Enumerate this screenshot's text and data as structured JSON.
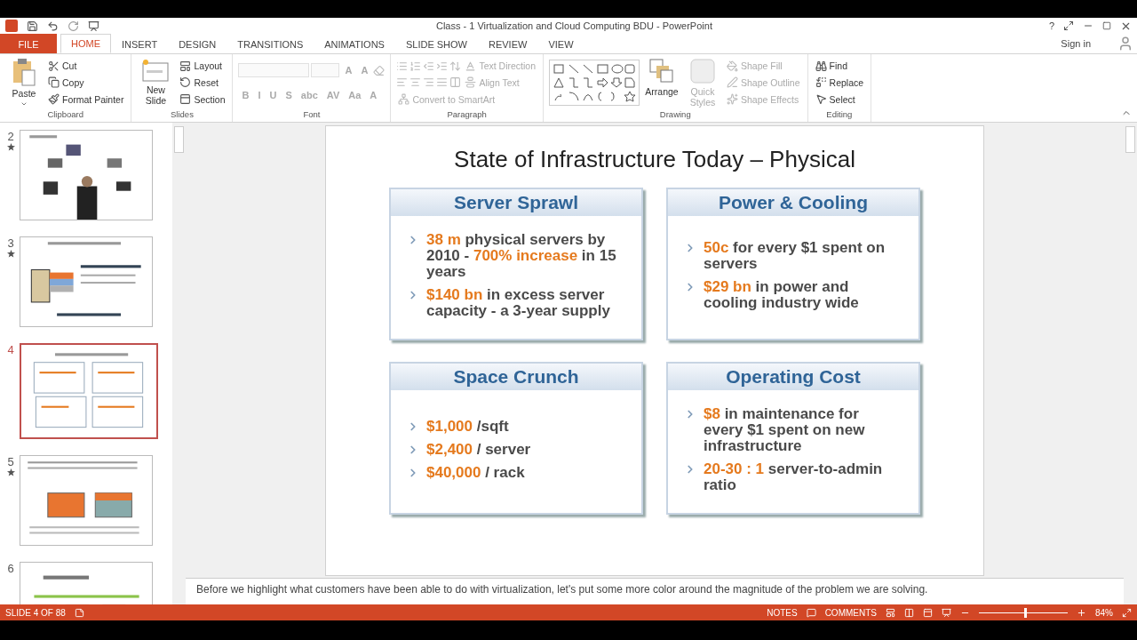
{
  "window": {
    "title": "Class - 1 Virtualization and Cloud Computing BDU - PowerPoint",
    "help": "?",
    "sign_in": "Sign in"
  },
  "tabs": [
    {
      "label": "FILE",
      "kind": "file",
      "selected": false
    },
    {
      "label": "HOME",
      "kind": "tab",
      "selected": true
    },
    {
      "label": "INSERT",
      "kind": "tab",
      "selected": false
    },
    {
      "label": "DESIGN",
      "kind": "tab",
      "selected": false
    },
    {
      "label": "TRANSITIONS",
      "kind": "tab",
      "selected": false
    },
    {
      "label": "ANIMATIONS",
      "kind": "tab",
      "selected": false
    },
    {
      "label": "SLIDE SHOW",
      "kind": "tab",
      "selected": false
    },
    {
      "label": "REVIEW",
      "kind": "tab",
      "selected": false
    },
    {
      "label": "VIEW",
      "kind": "tab",
      "selected": false
    }
  ],
  "ribbon": {
    "groups": [
      {
        "label": "Clipboard",
        "large": [
          {
            "kind": "paste",
            "label": "Paste",
            "disabled": false
          }
        ],
        "lines": [
          [
            {
              "kind": "cut",
              "label": "Cut",
              "disabled": false
            }
          ],
          [
            {
              "kind": "copy",
              "label": "Copy",
              "disabled": false
            }
          ],
          [
            {
              "kind": "painter",
              "label": "Format Painter",
              "disabled": false
            }
          ]
        ]
      },
      {
        "label": "Slides",
        "large": [
          {
            "kind": "new-slide",
            "label": "New Slide",
            "disabled": false
          }
        ],
        "lines": [
          [
            {
              "kind": "layout",
              "label": "Layout",
              "disabled": false
            }
          ],
          [
            {
              "kind": "reset",
              "label": "Reset",
              "disabled": false
            }
          ],
          [
            {
              "kind": "section",
              "label": "Section",
              "disabled": false
            }
          ]
        ]
      },
      {
        "label": "Font",
        "lines": [
          [
            {
              "kind": "font-field",
              "disabled": true
            },
            {
              "kind": "size-field",
              "disabled": true
            },
            {
              "kind": "letter",
              "label": "A",
              "disabled": true
            },
            {
              "kind": "letter",
              "label": "A",
              "disabled": true
            },
            {
              "kind": "eraser",
              "disabled": true
            }
          ],
          [
            {
              "kind": "letter",
              "label": "B",
              "disabled": true
            },
            {
              "kind": "letter",
              "label": "I",
              "disabled": true
            },
            {
              "kind": "letter",
              "label": "U",
              "disabled": true
            },
            {
              "kind": "letter",
              "label": "S",
              "disabled": true
            },
            {
              "kind": "letter",
              "label": "abc",
              "disabled": true
            },
            {
              "kind": "letter",
              "label": "AV",
              "disabled": true
            },
            {
              "kind": "letter",
              "label": "Aa",
              "disabled": true
            },
            {
              "kind": "letter",
              "label": "A",
              "disabled": true
            }
          ]
        ]
      },
      {
        "label": "Paragraph",
        "lines": [
          [
            {
              "kind": "bullets",
              "disabled": true
            },
            {
              "kind": "numbering",
              "disabled": true
            },
            {
              "kind": "outdent",
              "disabled": true
            },
            {
              "kind": "indent",
              "disabled": true
            },
            {
              "kind": "spacing",
              "disabled": true
            },
            {
              "kind": "text-direction",
              "label": "Text Direction",
              "disabled": true
            }
          ],
          [
            {
              "kind": "align-left",
              "disabled": true
            },
            {
              "kind": "align-center",
              "disabled": true
            },
            {
              "kind": "align-right",
              "disabled": true
            },
            {
              "kind": "justify",
              "disabled": true
            },
            {
              "kind": "columns",
              "disabled": true
            },
            {
              "kind": "align-text",
              "label": "Align Text",
              "disabled": true
            }
          ],
          [
            {
              "kind": "smartart",
              "label": "Convert to SmartArt",
              "disabled": true
            }
          ]
        ]
      },
      {
        "label": "Drawing",
        "large": [
          {
            "kind": "gallery",
            "disabled": false
          },
          {
            "kind": "arrange",
            "label": "Arrange",
            "disabled": false
          },
          {
            "kind": "quick-styles",
            "label": "Quick Styles",
            "disabled": true
          }
        ],
        "lines": [
          [
            {
              "kind": "fill",
              "label": "Shape Fill",
              "disabled": true
            }
          ],
          [
            {
              "kind": "outline",
              "label": "Shape Outline",
              "disabled": true
            }
          ],
          [
            {
              "kind": "effects",
              "label": "Shape Effects",
              "disabled": true
            }
          ]
        ]
      },
      {
        "label": "Editing",
        "lines": [
          [
            {
              "kind": "find",
              "label": "Find",
              "disabled": false
            }
          ],
          [
            {
              "kind": "replace",
              "label": "Replace",
              "disabled": false
            }
          ],
          [
            {
              "kind": "select",
              "label": "Select",
              "disabled": false
            }
          ]
        ]
      }
    ]
  },
  "thumbnails": [
    {
      "number": "2",
      "star": true,
      "selected": false
    },
    {
      "number": "3",
      "star": true,
      "selected": false
    },
    {
      "number": "4",
      "star": false,
      "selected": true
    },
    {
      "number": "5",
      "star": true,
      "selected": false
    },
    {
      "number": "6",
      "star": false,
      "selected": false
    }
  ],
  "slide": {
    "title": "State of Infrastructure Today – Physical",
    "panels": [
      {
        "heading": "Server Sprawl",
        "bullets": [
          "**38 m** physical servers by 2010 - **700% increase** in 15 years",
          "**$140 bn** in excess server capacity  -  a 3-year supply"
        ]
      },
      {
        "heading": "Power & Cooling",
        "bullets": [
          "**50c** for every $1 spent on servers",
          "**$29 bn** in power and cooling industry wide"
        ]
      },
      {
        "heading": "Space Crunch",
        "bullets": [
          "**$1,000** /sqft",
          "**$2,400** / server",
          "**$40,000** / rack"
        ]
      },
      {
        "heading": "Operating Cost",
        "bullets": [
          "**$8** in maintenance for every $1 spent on new infrastructure",
          "**20-30 : 1** server-to-admin ratio"
        ]
      }
    ]
  },
  "notes": "Before we highlight what customers have been able to do with virtualization, let's put some more color around the magnitude of the problem we are solving.",
  "status_bar": {
    "slide": "SLIDE 4 OF 88",
    "notes": "NOTES",
    "comments": "COMMENTS",
    "zoom": {
      "level": 0.52,
      "reading": "84%"
    }
  }
}
